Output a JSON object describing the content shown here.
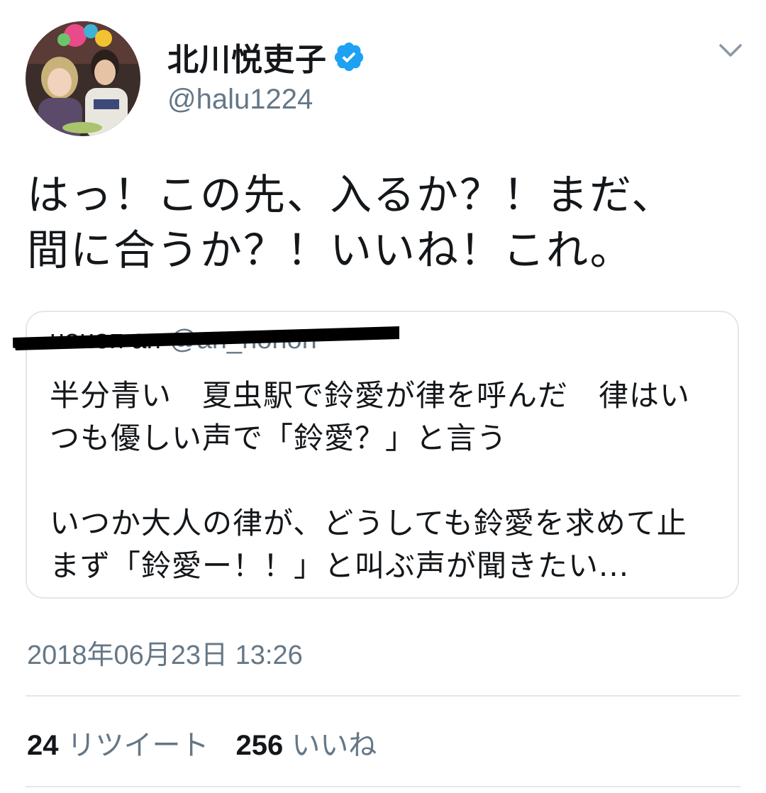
{
  "author": {
    "display_name": "北川悦吏子",
    "handle": "@halu1224",
    "verified": true
  },
  "tweet": {
    "text": "はっ！この先、入るか？！まだ、\n間に合うか？！いいね！これ。",
    "timestamp": "2018年06月23日 13:26"
  },
  "quote": {
    "author_name": "ноноп ап",
    "author_handle": "@an_nonon",
    "text": "半分青い　夏虫駅で鈴愛が律を呼んだ　律はい\nつも優しい声で「鈴愛？」と言う\n\nいつか大人の律が、どうしても鈴愛を求めて止\nまず「鈴愛ー！！」と叫ぶ声が聞きたい..."
  },
  "stats": {
    "retweets_count": "24",
    "retweets_label": "リツイート",
    "likes_count": "256",
    "likes_label": "いいね"
  },
  "colors": {
    "text_primary": "#14171a",
    "text_secondary": "#657786",
    "verified_blue": "#1da1f2",
    "border": "#e1e8ed",
    "redaction": "#000000"
  },
  "icons": {
    "verified": "verified-badge-icon",
    "menu": "chevron-down-icon"
  }
}
